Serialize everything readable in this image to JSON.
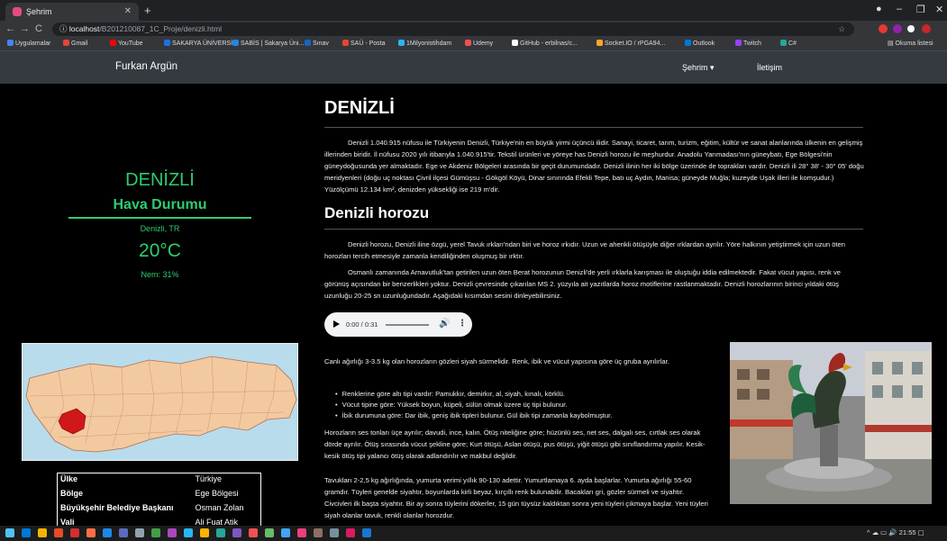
{
  "browser": {
    "tab_title": "Şehrim",
    "url_host": "localhost",
    "url_path": "/B201210087_1C_Proje/denizli.html",
    "bookmarks": [
      {
        "label": "Uygulamalar",
        "color": "#4285f4"
      },
      {
        "label": "Gmail",
        "color": "#ea4335"
      },
      {
        "label": "YouTube",
        "color": "#ff0000"
      },
      {
        "label": "SAKARYA ÜNİVERSİ...",
        "color": "#1a73e8"
      },
      {
        "label": "SABİS | Sakarya Üni...",
        "color": "#1e88e5"
      },
      {
        "label": "Sınav",
        "color": "#1565c0"
      },
      {
        "label": "SAÜ - Posta",
        "color": "#ea4335"
      },
      {
        "label": "1Milyonistihdam",
        "color": "#29b6f6"
      },
      {
        "label": "Udemy",
        "color": "#ec5252"
      },
      {
        "label": "GitHub - erbilnas/c...",
        "color": "#ffffff"
      },
      {
        "label": "Socket.IO / rPGA94...",
        "color": "#f9a825"
      },
      {
        "label": "Outlook",
        "color": "#0078d4"
      },
      {
        "label": "Twitch",
        "color": "#9146ff"
      },
      {
        "label": "C#",
        "color": "#26a69a"
      }
    ],
    "reading_list": "Okuma listesi"
  },
  "navbar": {
    "brand": "Furkan Argün",
    "sehir": "Şehrim ▾",
    "iletisim": "İletişim"
  },
  "sidebar": {
    "city": "DENİZLİ",
    "weather_heading": "Hava Durumu",
    "location": "Denizli, TR",
    "temperature": "20°C",
    "humidity": "Nem: 31%",
    "table": [
      {
        "key": "Ülke",
        "value": "Türkiye"
      },
      {
        "key": "Bölge",
        "value": "Ege Bölgesi"
      },
      {
        "key": "Büyükşehir Belediye Başkanı",
        "value": "Osman Zolan"
      },
      {
        "key": "Vali",
        "value": "Ali Fuat Atik"
      }
    ]
  },
  "main": {
    "title": "DENİZLİ",
    "intro": "Denizli 1.040.915 nüfusu ile Türkiyenin Denizli, Türkiye'nin en büyük yirmi üçüncü ilidir. Sanayi, ticaret, tarım, turizm, eğitim, kültür ve sanat alanlarında ülkenin en gelişmiş illerinden biridir. İl nüfusu 2020 yılı itibarıyla 1.040.915'tir. Tekstil ürünleri ve yöreye has Denizli horozu ile meşhurdur. Anadolu Yarımadası'nın güneybatı, Ege Bölgesi'nin güneydoğusunda yer almaktadır. Ege ve Akdeniz Bölgeleri arasında bir geçit durumundadır. Denizli ilinin her iki bölge üzerinde de toprakları vardır. Denizli ili 28° 38' - 30° 05' doğu meridyenleri (doğu uç noktası Çivril ilçesi Gümüşsu - Gökgöl Köyü, Dinar sınırında Efekli Tepe, batı uç Aydın, Manisa; güneyde Muğla; kuzeyde Uşak illeri ile komşudur.) Yüzölçümü 12.134 km², denizden yüksekliği ise 219 m'dir.",
    "subtitle": "Denizli horozu",
    "horoz_p1": "Denizli horozu, Denizli iline özgü, yerel Tavuk ırkları'ndan biri ve horoz ırkıdır. Uzun ve ahenkli ötüşüyle diğer ırklardan ayrılır. Yöre halkının yetiştirmek için uzun öten horozları tercih etmesiyle zamanla kendiliğinden oluşmuş bir ırktır.",
    "horoz_p2": "Osmanlı zamanında Arnavutluk'tan getirilen uzun öten Berat horozunun Denizli'de yerli ırklarla karışması ile oluştuğu iddia edilmektedir. Fakat vücut yapısı, renk ve görünüş açısından bir benzerlikleri yoktur. Denizli çevresinde çıkarılan MS 2. yüzyıla ait yazıtlarda horoz motiflerine rastlanmaktadır. Denizli horozlarının birinci yıldaki ötüş uzunluğu 20-25 sn uzunluğundadır. Aşağıdaki kısımdan sesini dinleyebilirsiniz.",
    "audio_time": "0:00 / 0:31",
    "eyes": "Canlı ağırlığı 3-3.5 kg olan horozların gözleri siyah sürmelidir. Renk, ibik ve vücut yapısına göre üç gruba ayrılırlar.",
    "bullets": [
      "Renklerine göre altı tipi vardır: Pamukkır, demirkır, al, siyah, kınalı, körklü.",
      "Vücut tipine göre: Yüksek boyun, küpeli, sülün olmak üzere üç tipi bulunur.",
      "İbik durumuna göre: Dar ibik, geniş ibik tipleri bulunur. Gül ibik tipi zamanla kaybolmuştur."
    ],
    "voice": "Horozların ses tonları üçe ayrılır; davudi, ince, kalın. Ötüş niteliğine göre; hüzünlü ses, net ses, dalgalı ses, cırtlak ses olarak dörde ayrılır. Ötüş sırasında vücut şekline göre; Kurt ötüşü, Aslan ötüşü, pus ötüşü, yiğit ötüşü gibi sınıflandırma yapılır. Kesik-kesik ötüş tipi yalancı ötüş olarak adlandırılır ve makbul değildir.",
    "hens": "Tavukları 2-2,5 kg ağırlığında, yumurta verimi yıllık 90-130 adettir. Yumurtlamaya 6. ayda başlarlar. Yumurta ağırlığı 55-60 gramdır. Tüyleri genelde siyahtır, boyunlarda kirli beyaz, kırçıllı renk bulunabilir. Bacakları gri, gözler sürmeli ve siyahtır. Civcivleri ilk başta siyahtır. Bir ay sonra tüylerini dökerler, 15 gün tüysüz kaldıktan sonra yeni tüyleri çıkmaya başlar. Yeni tüyleri siyah olanlar tavuk, renkli olanlar horozdur."
  },
  "taskbar": {
    "time": "21:55",
    "icons": [
      "#0078d7",
      "#f4b400",
      "#e34c26",
      "#d32f2f",
      "#ff7043",
      "#1e88e5",
      "#5c6bc0",
      "#90a4ae",
      "#43a047",
      "#ab47bc",
      "#29b6f6",
      "#ffb300",
      "#26a69a",
      "#7e57c2",
      "#ef5350",
      "#66bb6a",
      "#42a5f5",
      "#ec407a",
      "#8d6e63",
      "#78909c",
      "#d81b60",
      "#1976d2"
    ]
  }
}
